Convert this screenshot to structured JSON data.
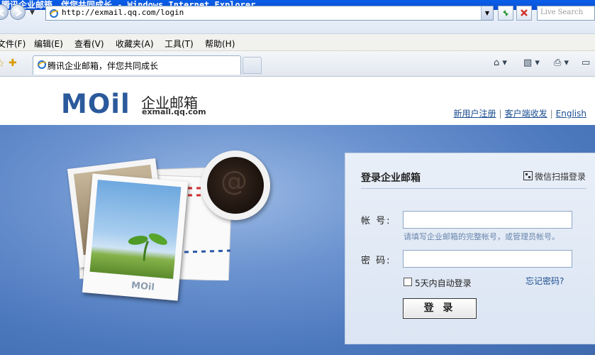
{
  "window": {
    "title": "腾讯企业邮箱，伴您共同成长 - Windows Internet Explorer"
  },
  "navbar": {
    "url": "http://exmail.qq.com/login",
    "search_placeholder": "Live Search"
  },
  "menubar": {
    "items": [
      "文件(F)",
      "编辑(E)",
      "查看(V)",
      "收藏夹(A)",
      "工具(T)",
      "帮助(H)"
    ]
  },
  "tabs": {
    "active_label": "腾讯企业邮箱，伴您共同成长"
  },
  "toolbar_icons": [
    "home-icon",
    "feeds-icon",
    "print-icon",
    "page-icon"
  ],
  "page": {
    "logo": {
      "mark": "MOil",
      "name": "企业邮箱",
      "domain": "exmail.qq.com"
    },
    "top_links": [
      "新用户注册",
      "客户端收发",
      "English"
    ],
    "illustration_mark": "MOil",
    "login": {
      "title": "登录企业邮箱",
      "qr_link": "微信扫描登录",
      "account_label": "帐  号:",
      "account_value": "",
      "account_hint": "请填写企业邮箱的完整帐号，或管理员帐号。",
      "password_label": "密  码:",
      "password_value": "",
      "remember_label": "5天内自动登录",
      "remember_checked": false,
      "forgot_link": "忘记密码?",
      "submit_label": "登 录"
    }
  },
  "colors": {
    "brand_blue": "#2b5a9c",
    "hero_blue": "#4b77bd",
    "link_blue": "#1a4d90"
  }
}
